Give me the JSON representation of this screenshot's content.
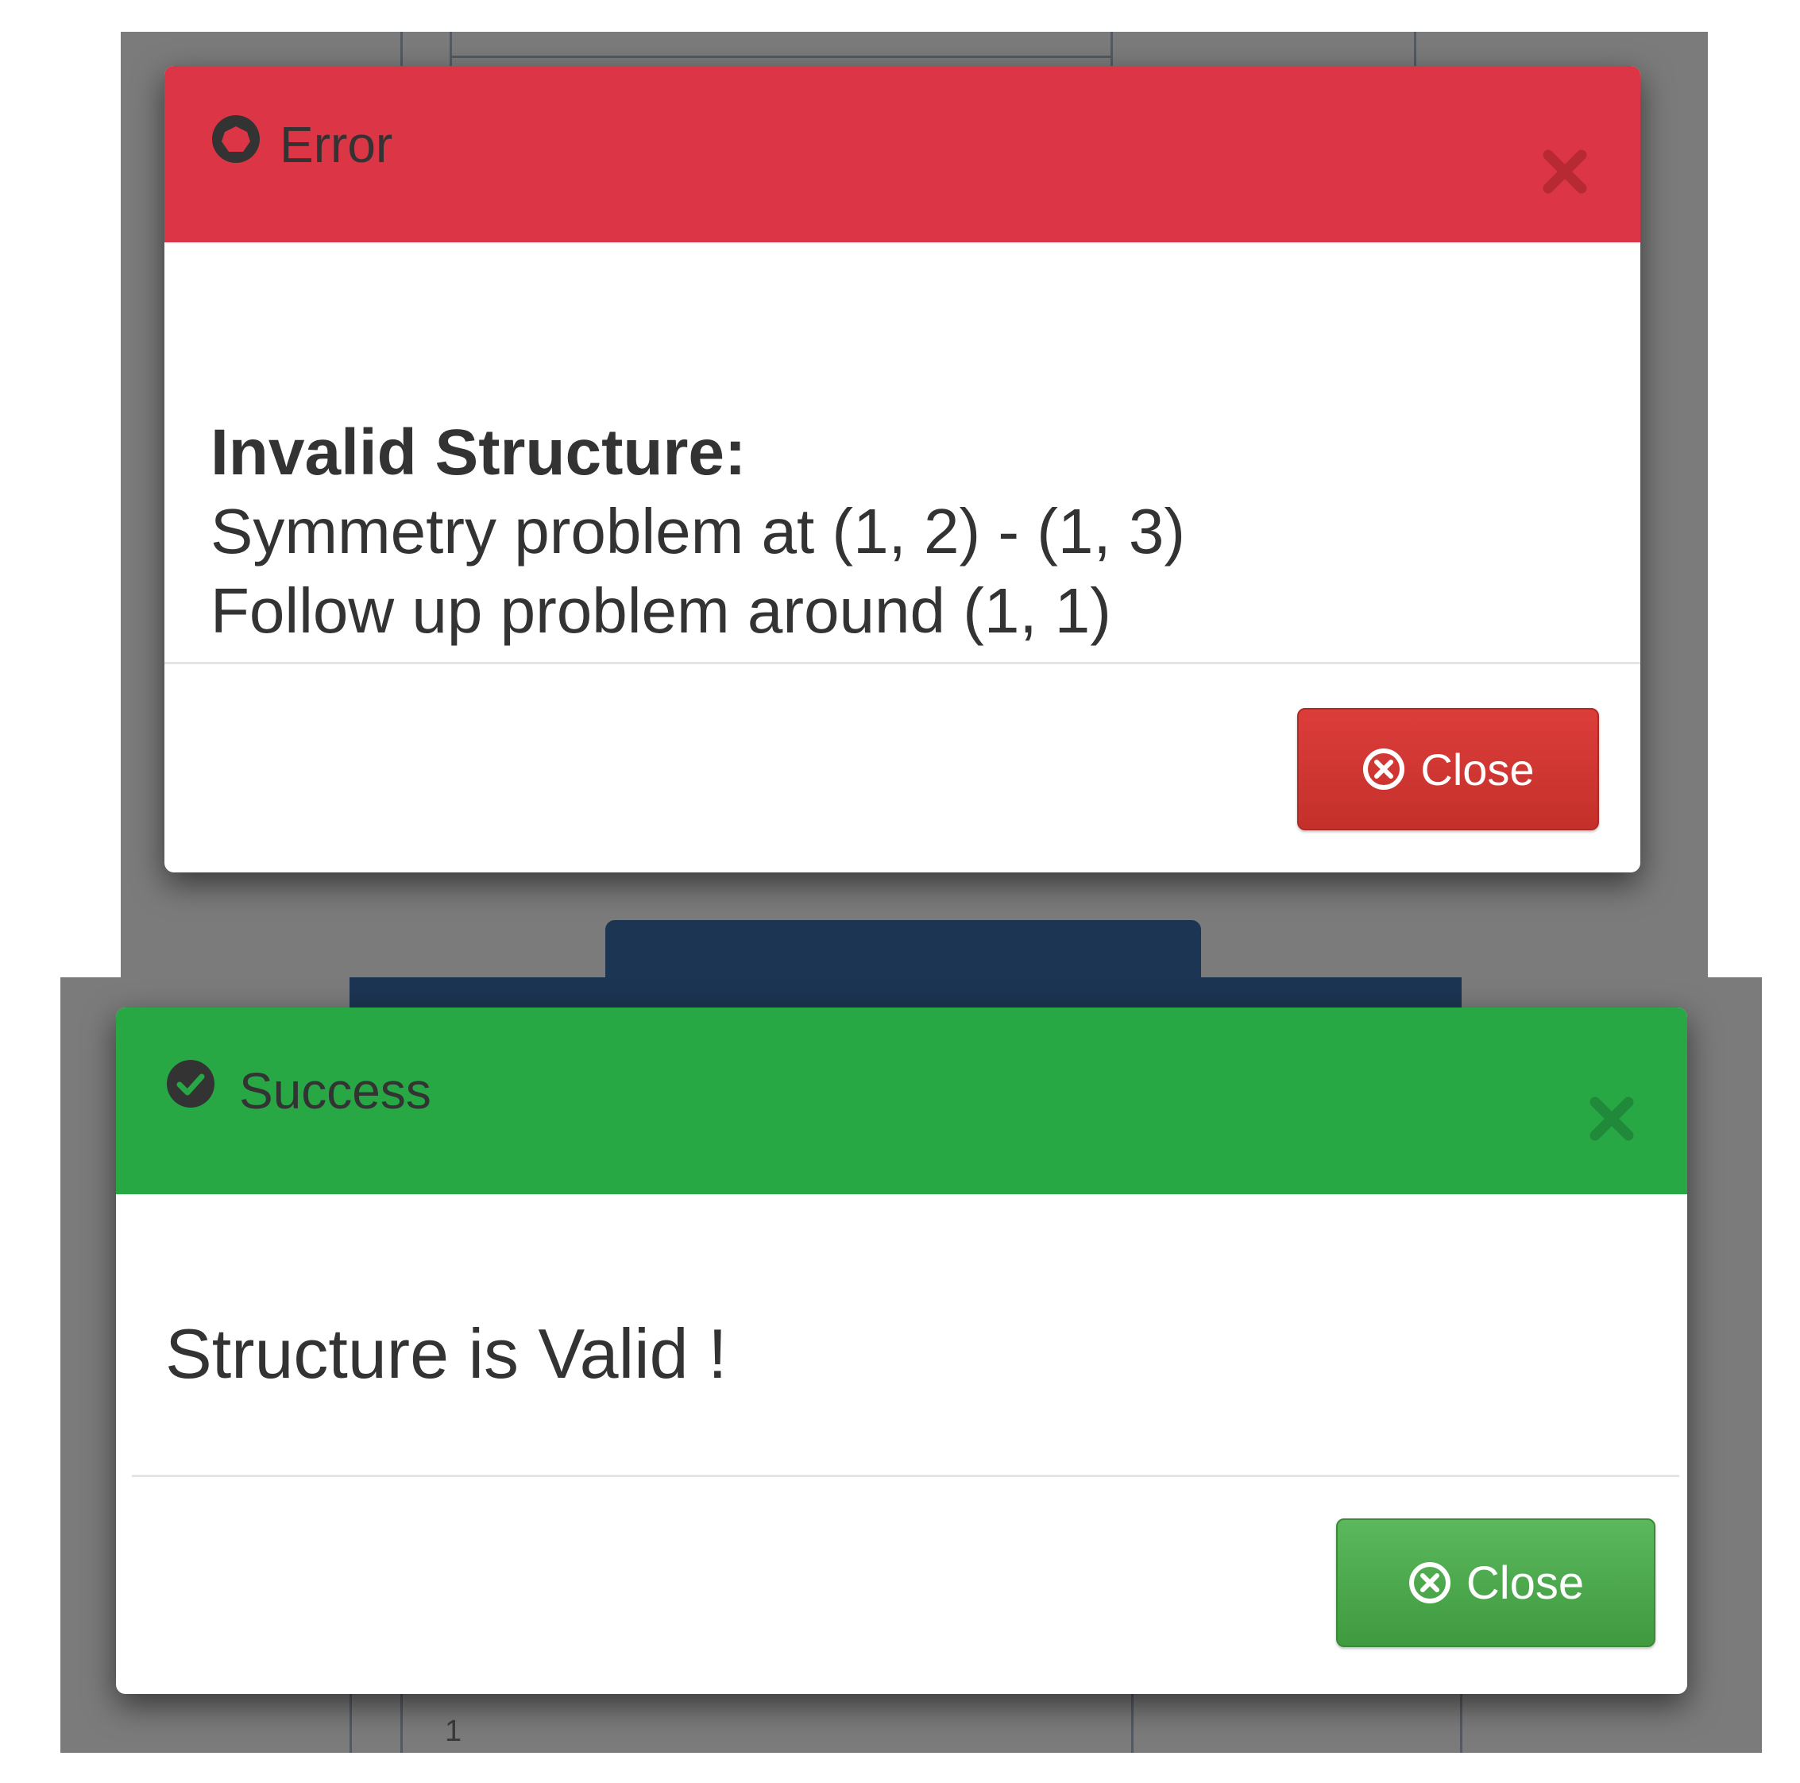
{
  "error_dialog": {
    "title": "Error",
    "icon": "error-icon",
    "close_icon": "close-x-icon",
    "heading": "Invalid Structure:",
    "lines": [
      "Symmetry problem at (1, 2) - (1, 3)",
      "Follow up problem around (1, 1)"
    ],
    "button_label": "Close",
    "button_icon": "circle-x-icon",
    "header_color": "#dc3545",
    "button_color": "#d9342f"
  },
  "success_dialog": {
    "title": "Success",
    "icon": "check-circle-icon",
    "close_icon": "close-x-icon",
    "message": "Structure is Valid !",
    "button_label": "Close",
    "button_icon": "circle-x-icon",
    "header_color": "#28a745",
    "button_color": "#4cae4c"
  },
  "background": {
    "cell_text": "1"
  }
}
